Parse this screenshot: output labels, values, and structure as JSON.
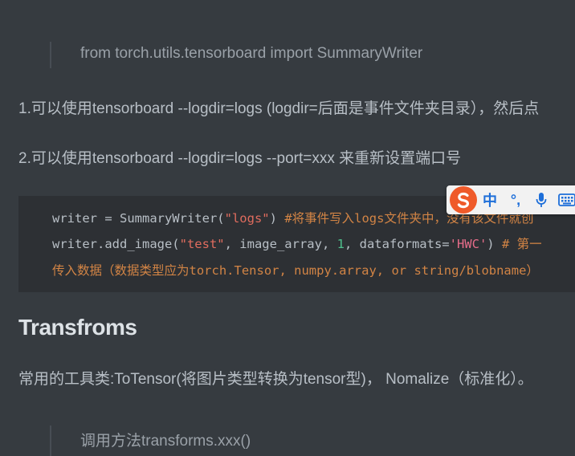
{
  "blockquote_top": {
    "text": "from torch.utils.tensorboard import SummaryWriter"
  },
  "paragraphs": {
    "p1": "1.可以使用tensorboard --logdir=logs (logdir=后面是事件文件夹目录），然后点",
    "p2": "2.可以使用tensorboard --logdir=logs --port=xxx 来重新设置端口号",
    "p3": "常用的工具类:ToTensor(将图片类型转换为tensor型)， Nomalize（标准化）。"
  },
  "code": {
    "line1": {
      "prefix": "writer = SummaryWriter(",
      "string": "\"logs\"",
      "suffix": ") ",
      "comment": "#将事件写入logs文件夹中，没有该文件就创"
    },
    "line2": {
      "prefix": "writer.add_image(",
      "string1": "\"test\"",
      "mid1": ", image_array, ",
      "number": "1",
      "mid2": ", dataformats=",
      "string2": "'HWC'",
      "suffix": ") ",
      "comment": "# 第一"
    },
    "line3": {
      "comment": "传入数据（数据类型应为torch.Tensor, numpy.array, or string/blobname）"
    }
  },
  "heading": "Transfroms",
  "blockquote_bottom": {
    "text": "调用方法transforms.xxx()"
  },
  "ime_toolbar": {
    "logo_icon": "sogou-logo-icon",
    "lang_label": "中",
    "punct_label": "°,",
    "mic_icon": "microphone-icon",
    "keyboard_icon": "keyboard-icon",
    "colors": {
      "brand": "#ef5a2a",
      "accent": "#1e6fd9"
    }
  },
  "colors": {
    "background": "#363b40",
    "code_background": "#2d3034",
    "text": "#b8bfc6",
    "heading": "#dde2e6"
  }
}
